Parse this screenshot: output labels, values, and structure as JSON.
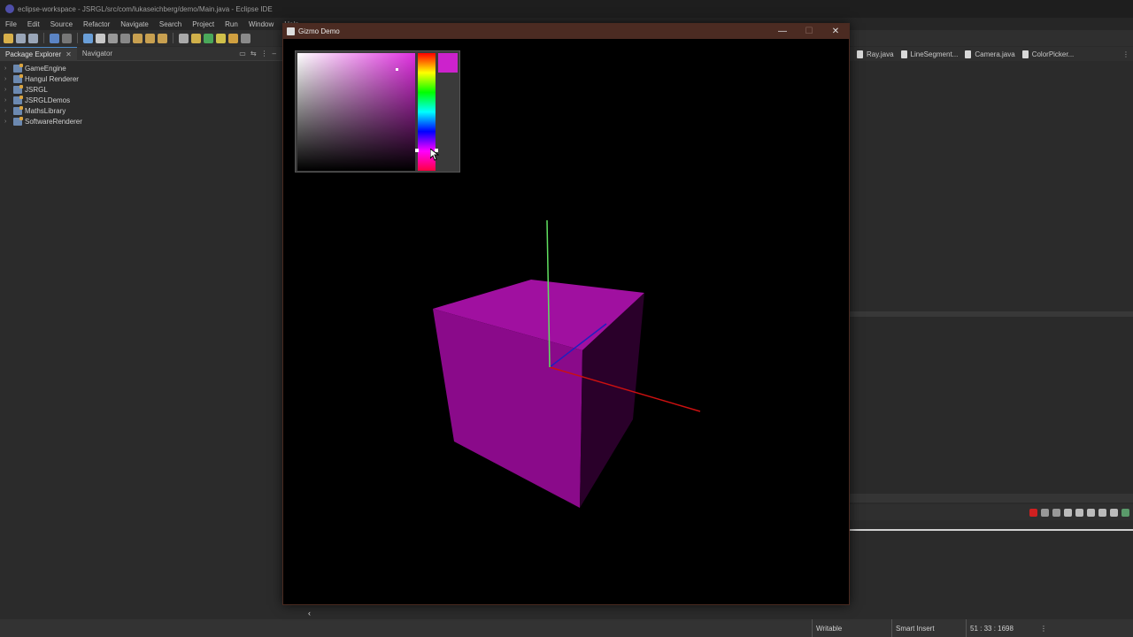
{
  "eclipse": {
    "title": "eclipse-workspace - JSRGL/src/com/lukaseichberg/demo/Main.java - Eclipse IDE",
    "menu": [
      "File",
      "Edit",
      "Source",
      "Refactor",
      "Navigate",
      "Search",
      "Project",
      "Run",
      "Window",
      "Help"
    ]
  },
  "left_panel": {
    "tabs": [
      {
        "label": "Package Explorer",
        "active": true
      },
      {
        "label": "Navigator",
        "active": false
      }
    ],
    "projects": [
      "GameEngine",
      "Hangul Renderer",
      "JSRGL",
      "JSRGLDemos",
      "MathsLibrary",
      "SoftwareRenderer"
    ]
  },
  "editor_tabs": [
    "Ray.java",
    "LineSegment...",
    "Camera.java",
    "ColorPicker..."
  ],
  "statusbar": {
    "writable": "Writable",
    "insert_mode": "Smart Insert",
    "position": "51 : 33 : 1698"
  },
  "gizmo_window": {
    "title": "Gizmo Demo",
    "selected_color": "#cc22cc",
    "cube_color": "#a010a0",
    "axis_colors": {
      "x": "#cc1010",
      "y": "#60e060",
      "z": "#2020c0"
    }
  }
}
